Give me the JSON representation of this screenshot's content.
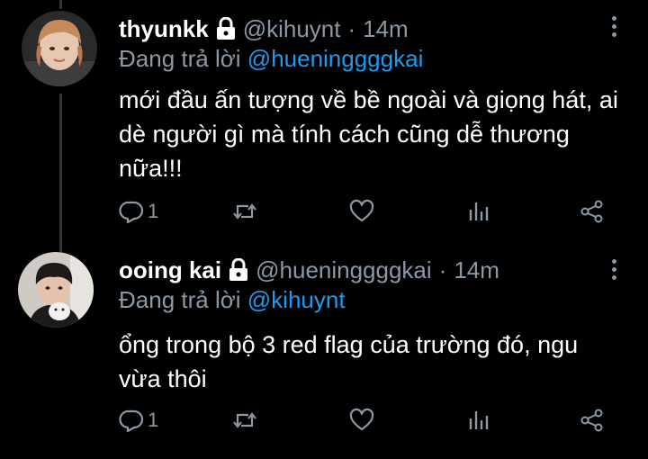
{
  "colors": {
    "background": "#000000",
    "text": "#ffffff",
    "muted": "#8b98a5",
    "link": "#1d9bf0",
    "thread_line": "#333639"
  },
  "tweets": [
    {
      "display_name": "thyunkk",
      "protected_icon": "lock-icon",
      "handle": "@kihuynt",
      "separator": "·",
      "time": "14m",
      "reply_prefix": "Đang trả lời",
      "reply_to": "@hueninggggkai",
      "text": "mới đầu ấn tượng về bề ngoài và giọng hát, ai dè người gì mà tính cách cũng dễ thương nữa!!!",
      "reply_count": "1",
      "icons": [
        "reply-icon",
        "retweet-icon",
        "like-icon",
        "views-icon",
        "share-icon"
      ]
    },
    {
      "display_name": "ooing kai",
      "protected_icon": "lock-icon",
      "handle": "@hueninggggkai",
      "separator": "·",
      "time": "14m",
      "reply_prefix": "Đang trả lời",
      "reply_to": "@kihuynt",
      "text": "ổng trong bộ 3 red flag của trường đó, ngu vừa thôi",
      "reply_count": "1",
      "icons": [
        "reply-icon",
        "retweet-icon",
        "like-icon",
        "views-icon",
        "share-icon"
      ]
    }
  ]
}
